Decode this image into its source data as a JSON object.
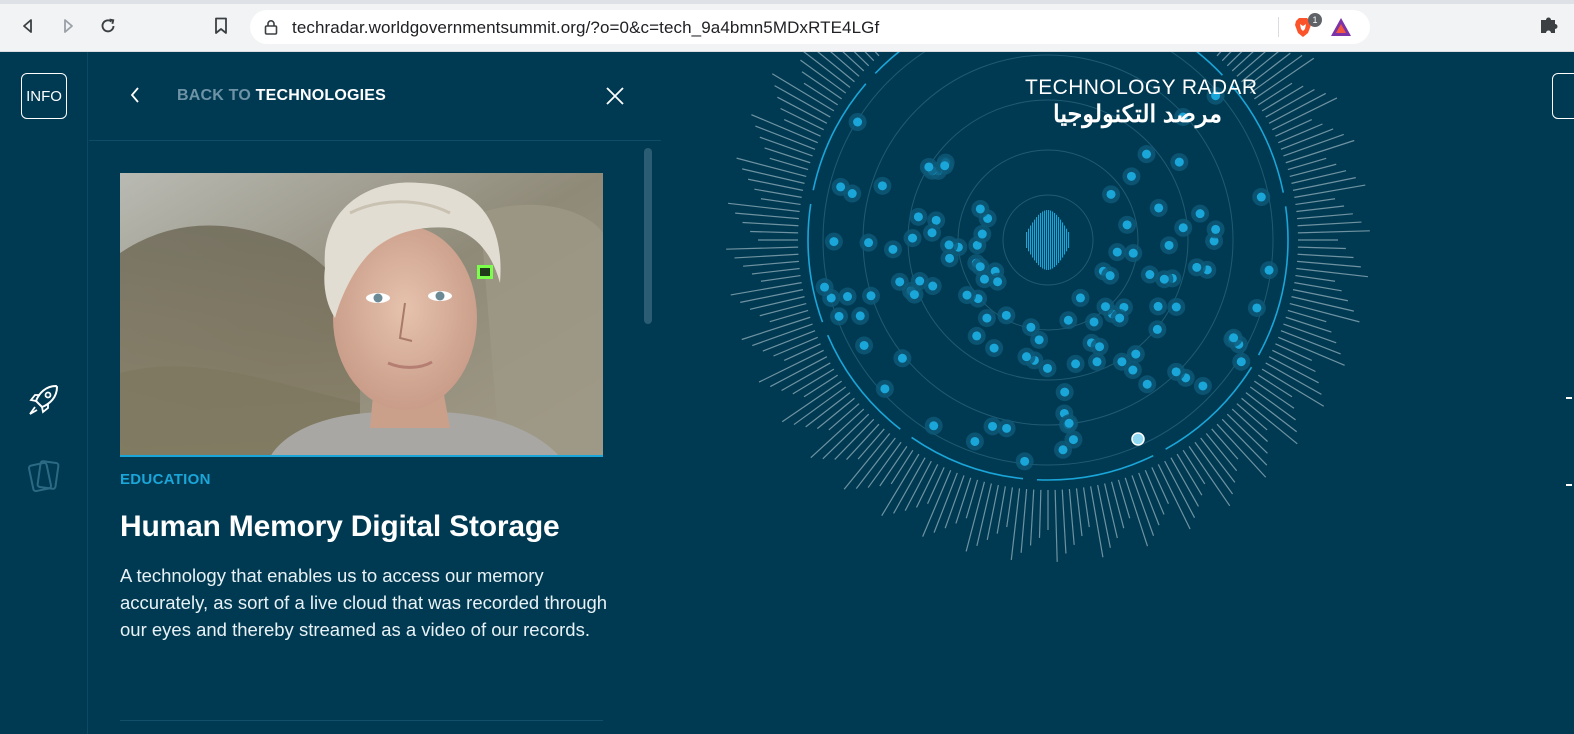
{
  "browser": {
    "url": "techradar.worldgovernmentsummit.org/?o=0&c=tech_9a4bmn5MDxRTE4LGf",
    "brave_shields_count": "1",
    "icons": [
      "back-icon",
      "forward-icon",
      "reload-icon",
      "bookmark-icon",
      "lock-icon",
      "brave-shields-icon",
      "brave-rewards-icon",
      "extensions-icon"
    ]
  },
  "rail": {
    "info_label": "INFO",
    "icons": [
      "rocket-icon",
      "cards-icon"
    ]
  },
  "panel": {
    "back_prefix": "BACK TO ",
    "back_target": "TECHNOLOGIES",
    "category": "EDUCATION",
    "title": "Human Memory Digital Storage",
    "description": "A technology that enables us to access our memory accurately, as sort of a live cloud that was recorded through our eyes and thereby streamed as a video of our records."
  },
  "radar": {
    "title_en": "TECHNOLOGY RADAR",
    "title_ar": "مرصد التكنولوجيا",
    "accent_color": "#1aa6d9",
    "background_color": "#003a52"
  }
}
